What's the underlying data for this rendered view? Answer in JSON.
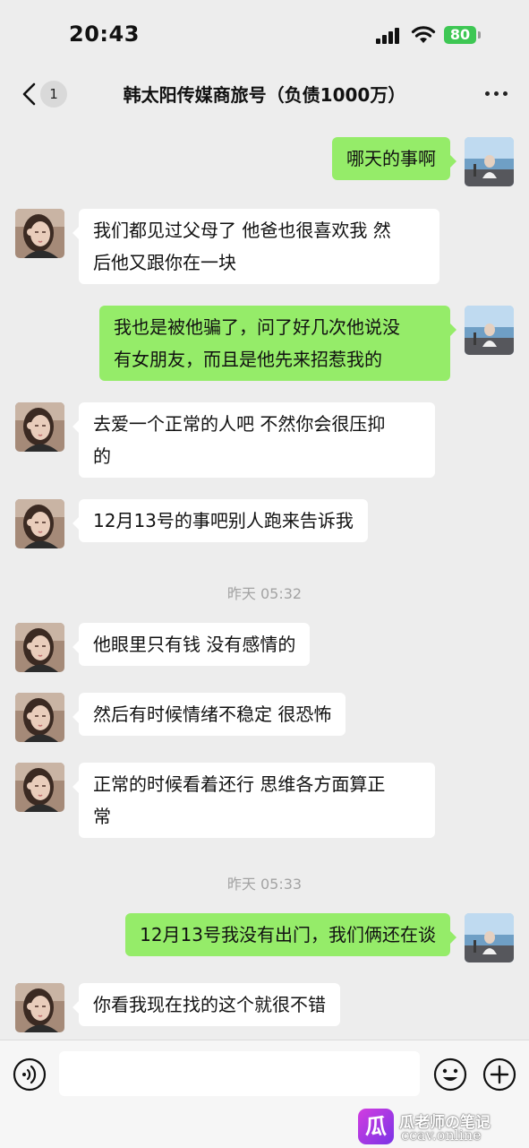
{
  "status_bar": {
    "time": "20:43",
    "battery": "80"
  },
  "header": {
    "back_icon": "chevron-left-icon",
    "unread_count": "1",
    "title": "韩太阳传媒商旅号（负债1000万）",
    "more_icon": "more-dots-icon"
  },
  "messages": [
    {
      "side": "out",
      "text": "哪天的事啊"
    },
    {
      "side": "in",
      "text_lines": [
        "我们都见过父母了 他爸也很喜欢我 然",
        "后他又跟你在一块"
      ]
    },
    {
      "side": "out",
      "text_lines": [
        "我也是被他骗了，问了好几次他说没",
        "有女朋友，而且是他先来招惹我的"
      ]
    },
    {
      "side": "in",
      "text_lines": [
        "去爱一个正常的人吧 不然你会很压抑",
        "的"
      ]
    },
    {
      "side": "in",
      "text": "12月13号的事吧别人跑来告诉我"
    },
    {
      "type": "timestamp",
      "text": "昨天 05:32"
    },
    {
      "side": "in",
      "text": "他眼里只有钱 没有感情的"
    },
    {
      "side": "in",
      "text": "然后有时候情绪不稳定 很恐怖"
    },
    {
      "side": "in",
      "text_lines": [
        "正常的时候看着还行 思维各方面算正",
        "常"
      ]
    },
    {
      "type": "timestamp",
      "text": "昨天 05:33"
    },
    {
      "side": "out",
      "text": "12月13号我没有出门，我们俩还在谈"
    },
    {
      "side": "in",
      "text": "你看我现在找的这个就很不错"
    }
  ],
  "input_bar": {
    "voice_icon": "voice-icon",
    "message_value": "",
    "emoji_icon": "emoji-icon",
    "plus_icon": "plus-icon"
  },
  "watermark": {
    "logo_char": "瓜",
    "name": "瓜老师の笔记",
    "url": "ccav.online"
  },
  "colors": {
    "background": "#ededed",
    "outgoing_bubble": "#95ec69",
    "incoming_bubble": "#ffffff",
    "battery": "#3ec754"
  }
}
